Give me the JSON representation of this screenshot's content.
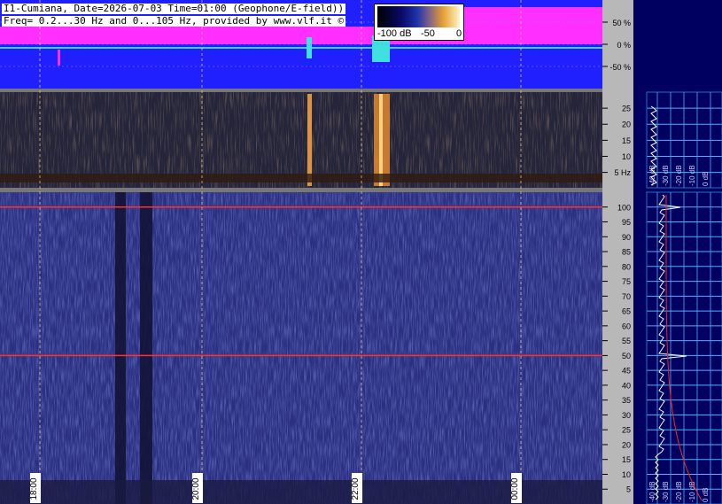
{
  "header": {
    "line1": "I1-Cumiana, Date=2026-07-03 Time=01:00 (Geophone/E-field))",
    "line2": "Freq= 0.2...30 Hz and 0...105 Hz, provided by www.vlf.it ©"
  },
  "colors": {
    "waveform_bg": "#2020ff",
    "waveform_trace": "#ff30ff",
    "spectrogram_bg": "#2b2f80",
    "lower_axis_bg": "#000060",
    "grid_line": "#4fb0ff",
    "fiftyhz_line": "#ff3030",
    "time_marker": "#ffd080",
    "spectrum_trace": "#ffffff",
    "noise_curve": "#ff2020"
  },
  "color_scale": {
    "labels": [
      "-100 dB",
      "-50",
      "0"
    ]
  },
  "chart_data": [
    {
      "type": "line",
      "panel": "waveform amplitude",
      "yticks": [
        "50 %",
        "0 %",
        "-50 %"
      ],
      "ytick_values": [
        50,
        0,
        -50
      ],
      "ylim": [
        -100,
        100
      ],
      "grid": true
    },
    {
      "type": "heatmap",
      "panel": "low-frequency spectrogram (geophone)",
      "ylabel_unit": "Hz",
      "yticks": [
        "25",
        "20",
        "15",
        "10",
        "5 Hz"
      ],
      "ytick_values": [
        25,
        20,
        15,
        10,
        5
      ],
      "ylim": [
        0.2,
        30
      ],
      "bright_vertical_bursts_x": [
        "20:40",
        "22:18",
        "22:22"
      ]
    },
    {
      "type": "line",
      "panel": "average spectrum (low band)",
      "xticks": [
        "-40 dB",
        "-30 dB",
        "-20 dB",
        "-10 dB",
        "0 dB"
      ],
      "grid": true
    },
    {
      "type": "heatmap",
      "panel": "high-frequency spectrogram (E-field)",
      "yticks": [
        "100",
        "95",
        "90",
        "85",
        "80",
        "75",
        "70",
        "65",
        "60",
        "55",
        "50",
        "45",
        "40",
        "35",
        "30",
        "25",
        "20",
        "15",
        "10",
        "5"
      ],
      "ytick_values": [
        100,
        95,
        90,
        85,
        80,
        75,
        70,
        65,
        60,
        55,
        50,
        45,
        40,
        35,
        30,
        25,
        20,
        15,
        10,
        5
      ],
      "ylim": [
        0,
        105
      ],
      "xticks": [
        "18:00",
        "20:00",
        "22:00",
        "00:00"
      ],
      "highlighted_lines_hz": [
        50,
        100
      ],
      "grid": true
    },
    {
      "type": "line",
      "panel": "average spectrum (high band)",
      "xticks": [
        "-40 dB",
        "-30 dB",
        "-20 dB",
        "-10 dB",
        "0 dB"
      ],
      "peaks_hz": [
        50,
        100
      ],
      "grid": true
    }
  ]
}
